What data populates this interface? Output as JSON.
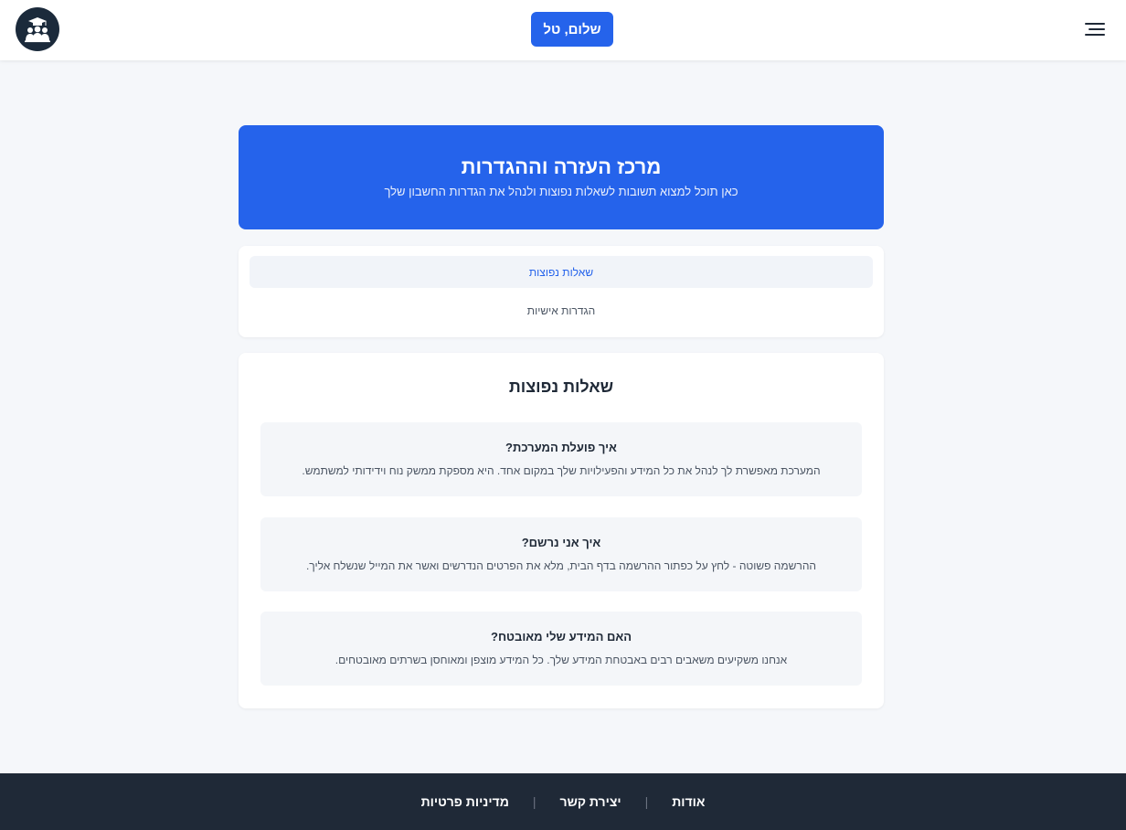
{
  "header": {
    "greeting": "שלום, טל",
    "logo_icon": "graduation-group-icon",
    "menu_icon": "hamburger-menu-icon"
  },
  "hero": {
    "title": "מרכז העזרה וההגדרות",
    "subtitle": "כאן תוכל למצוא תשובות לשאלות נפוצות ולנהל את הגדרות החשבון שלך"
  },
  "tabs": [
    {
      "label": "שאלות נפוצות",
      "active": true
    },
    {
      "label": "הגדרות אישיות",
      "active": false
    }
  ],
  "faq": {
    "title": "שאלות נפוצות",
    "items": [
      {
        "question": "איך פועלת המערכת?",
        "answer": "המערכת מאפשרת לך לנהל את כל המידע והפעילויות שלך במקום אחד. היא מספקת ממשק נוח וידידותי למשתמש."
      },
      {
        "question": "איך אני נרשם?",
        "answer": "ההרשמה פשוטה - לחץ על כפתור ההרשמה בדף הבית, מלא את הפרטים הנדרשים ואשר את המייל שנשלח אליך."
      },
      {
        "question": "האם המידע שלי מאובטח?",
        "answer": "אנחנו משקיעים משאבים רבים באבטחת המידע שלך. כל המידע מוצפן ומאוחסן בשרתים מאובטחים."
      }
    ]
  },
  "footer": {
    "links": [
      "אודות",
      "יצירת קשר",
      "מדיניות פרטיות"
    ],
    "separator": "|"
  },
  "colors": {
    "primary": "#2563eb",
    "background": "#f5f7fa",
    "footer": "#1f2937",
    "logo": "#1b2a3b"
  }
}
